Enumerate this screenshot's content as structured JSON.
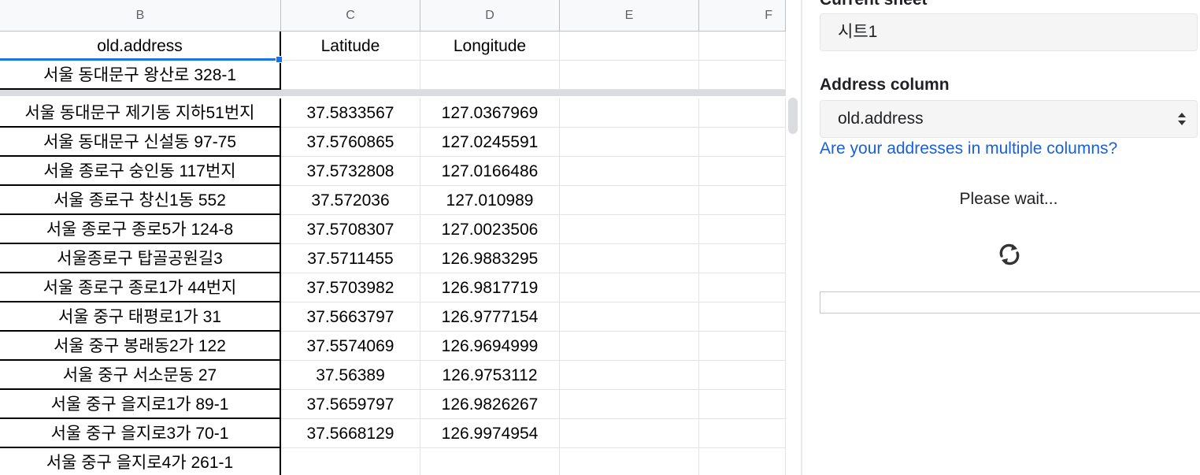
{
  "spreadsheet": {
    "columns": [
      {
        "letter": "B"
      },
      {
        "letter": "C"
      },
      {
        "letter": "D"
      },
      {
        "letter": "E"
      },
      {
        "letter": "F"
      }
    ],
    "header_row": {
      "b": "old.address",
      "c": "Latitude",
      "d": "Longitude"
    },
    "frozen_row": {
      "b": "서울 동대문구 왕산로 328-1",
      "c": "",
      "d": ""
    },
    "rows": [
      {
        "b": "서울 동대문구 제기동 지하51번지",
        "c": "37.5833567",
        "d": "127.0367969"
      },
      {
        "b": "서울 동대문구 신설동 97-75",
        "c": "37.5760865",
        "d": "127.0245591"
      },
      {
        "b": "서울 종로구 숭인동 117번지",
        "c": "37.5732808",
        "d": "127.0166486"
      },
      {
        "b": "서울 종로구 창신1동 552",
        "c": "37.572036",
        "d": "127.010989"
      },
      {
        "b": "서울 종로구 종로5가 124-8",
        "c": "37.5708307",
        "d": "127.0023506"
      },
      {
        "b": "서울종로구 탑골공원길3",
        "c": "37.5711455",
        "d": "126.9883295"
      },
      {
        "b": "서울 종로구 종로1가 44번지",
        "c": "37.5703982",
        "d": "126.9817719"
      },
      {
        "b": "서울 중구 태평로1가 31",
        "c": "37.5663797",
        "d": "126.9777154"
      },
      {
        "b": "서울 중구 봉래동2가 122",
        "c": "37.5574069",
        "d": "126.9694999"
      },
      {
        "b": "서울 중구 서소문동 27",
        "c": "37.56389",
        "d": "126.9753112"
      },
      {
        "b": "서울 중구 을지로1가 89-1",
        "c": "37.5659797",
        "d": "126.9826267"
      },
      {
        "b": "서울 중구 을지로3가 70-1",
        "c": "37.5668129",
        "d": "126.9974954"
      },
      {
        "b": "서울 중구 을지로4가 261-1",
        "c": "",
        "d": ""
      }
    ]
  },
  "panel": {
    "current_sheet_label": "Current sheet",
    "current_sheet_value": "시트1",
    "address_column_label": "Address column",
    "address_column_value": "old.address",
    "multi_column_link": "Are your addresses in multiple columns?",
    "status_text": "Please wait...",
    "spinner_icon": "refresh-icon",
    "progress_fraction": 0
  },
  "colors": {
    "accent": "#1a73e8",
    "link": "#1a5fd6"
  }
}
